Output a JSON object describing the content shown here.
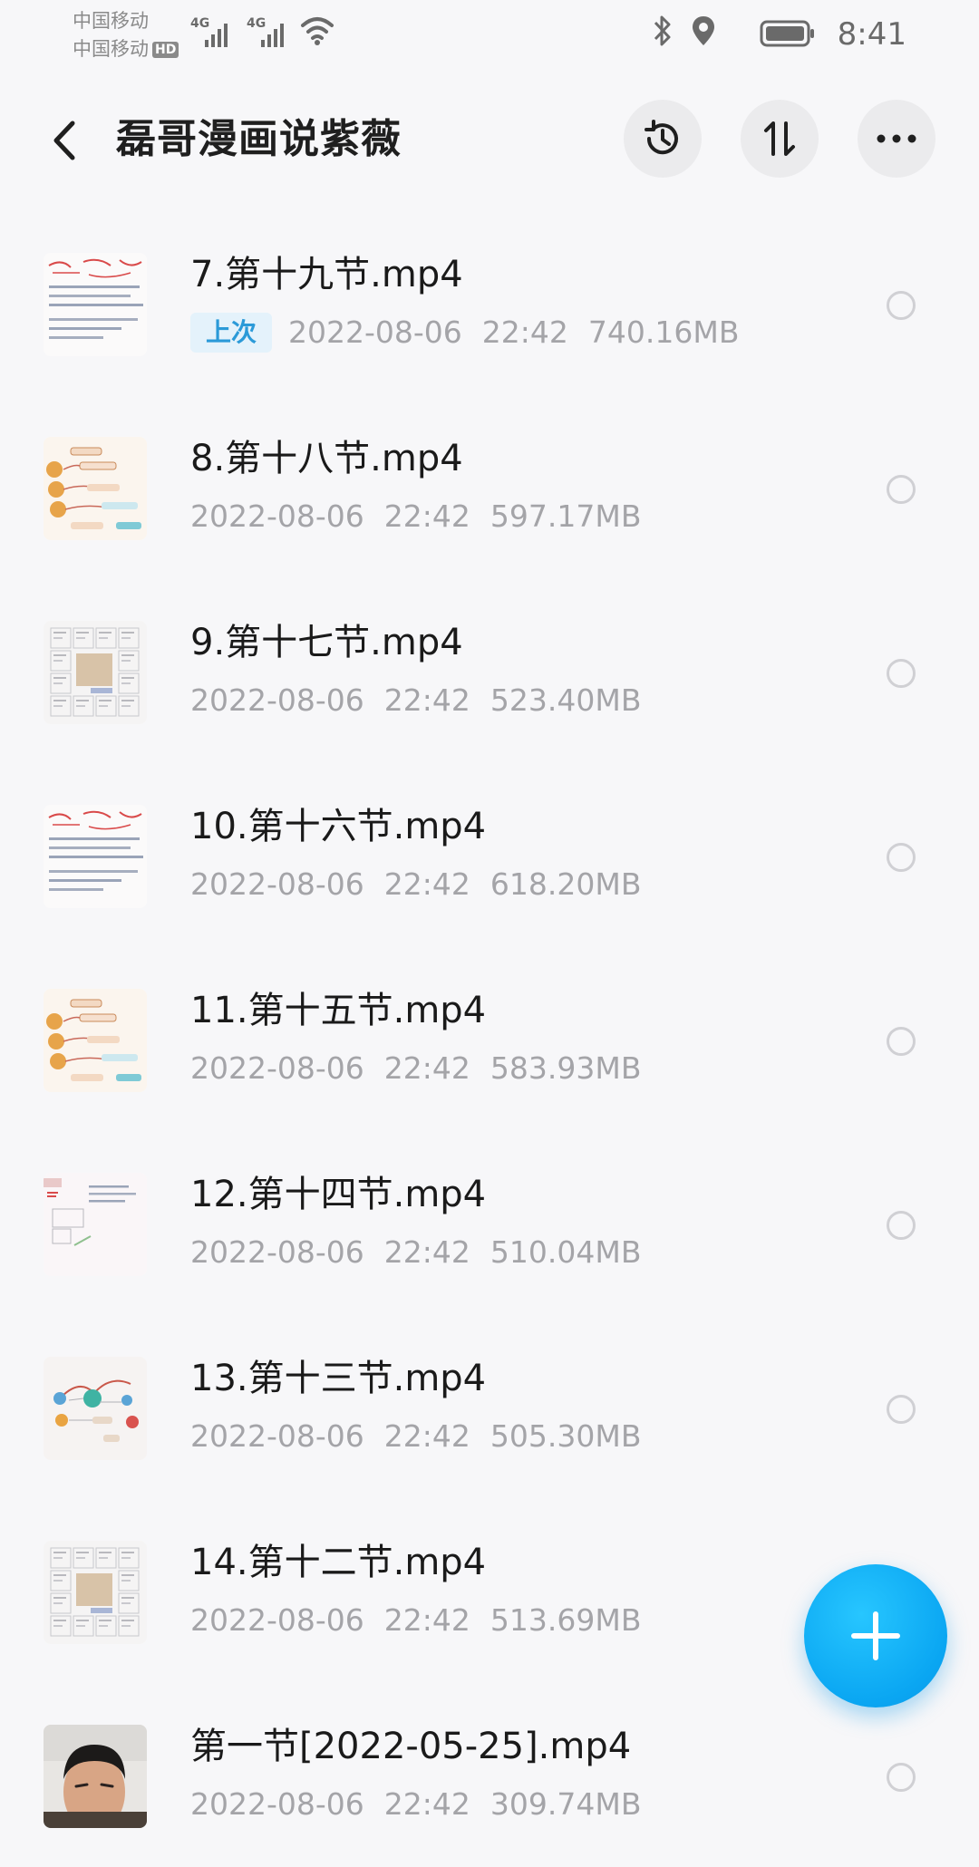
{
  "status_bar": {
    "carrier_1": "中国移动",
    "carrier_2": "中国移动",
    "hd_label": "HD",
    "network_1": "4G",
    "network_2": "4G",
    "time": "8:41"
  },
  "header": {
    "title": "磊哥漫画说紫薇",
    "icons": [
      "back-arrow-icon",
      "history-icon",
      "sort-icon",
      "more-icon"
    ]
  },
  "files": [
    {
      "name": "7.第十九节.mp4",
      "badge": "上次",
      "date": "2022-08-06",
      "time": "22:42",
      "size": "740.16MB",
      "thumb": "notes-red"
    },
    {
      "name": "8.第十八节.mp4",
      "badge": "",
      "date": "2022-08-06",
      "time": "22:42",
      "size": "597.17MB",
      "thumb": "mindmap"
    },
    {
      "name": "9.第十七节.mp4",
      "badge": "",
      "date": "2022-08-06",
      "time": "22:42",
      "size": "523.40MB",
      "thumb": "chart-grid"
    },
    {
      "name": "10.第十六节.mp4",
      "badge": "",
      "date": "2022-08-06",
      "time": "22:42",
      "size": "618.20MB",
      "thumb": "notes-red"
    },
    {
      "name": "11.第十五节.mp4",
      "badge": "",
      "date": "2022-08-06",
      "time": "22:42",
      "size": "583.93MB",
      "thumb": "mindmap"
    },
    {
      "name": "12.第十四节.mp4",
      "badge": "",
      "date": "2022-08-06",
      "time": "22:42",
      "size": "510.04MB",
      "thumb": "notes-plain"
    },
    {
      "name": "13.第十三节.mp4",
      "badge": "",
      "date": "2022-08-06",
      "time": "22:42",
      "size": "505.30MB",
      "thumb": "mindmap-circle"
    },
    {
      "name": "14.第十二节.mp4",
      "badge": "",
      "date": "2022-08-06",
      "time": "22:42",
      "size": "513.69MB",
      "thumb": "chart-grid"
    },
    {
      "name": "第一节[2022-05-25].mp4",
      "badge": "",
      "date": "2022-08-06",
      "time": "22:42",
      "size": "309.74MB",
      "thumb": "person"
    }
  ],
  "fab": {
    "icon": "plus-icon"
  },
  "colors": {
    "accent": "#0aa6f2",
    "badge_bg": "#e4f2fb",
    "badge_text": "#2b9ad8",
    "meta_text": "#a4a4a8"
  }
}
